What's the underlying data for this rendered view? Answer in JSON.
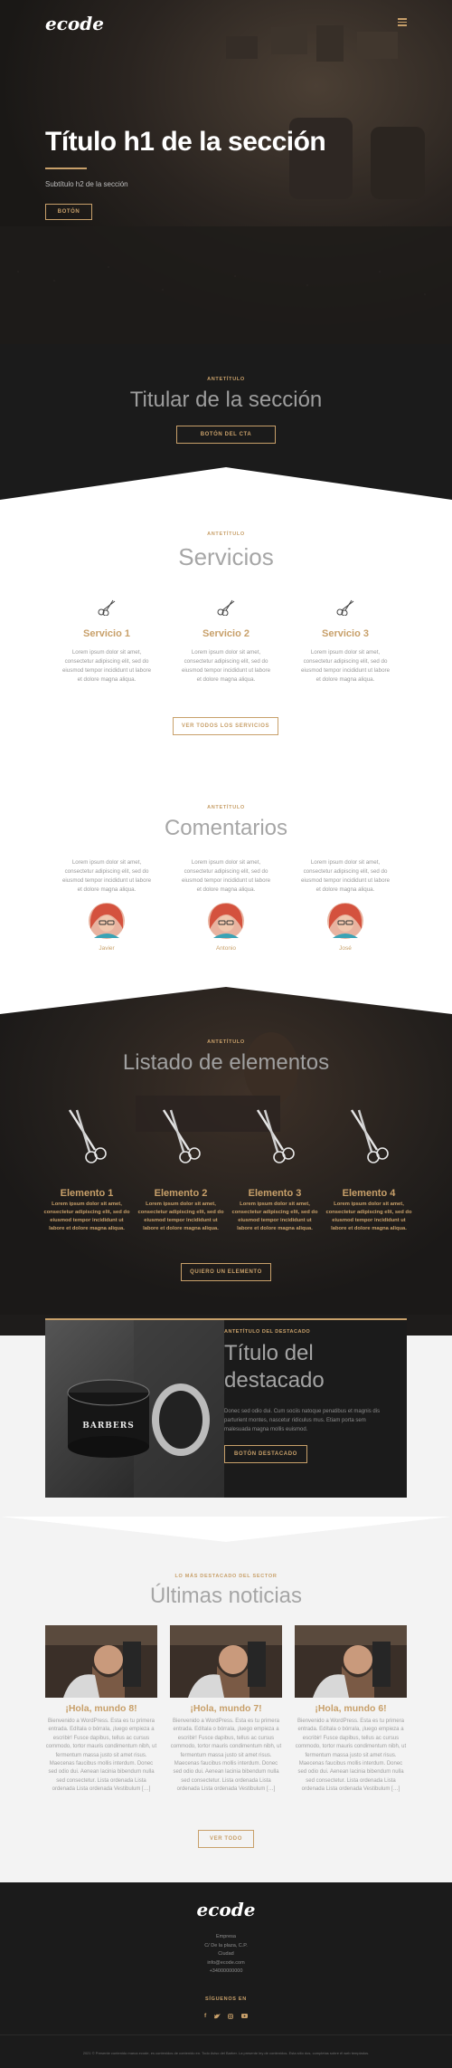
{
  "header": {
    "logo": "ecode",
    "menu_icon": "hamburger-icon"
  },
  "hero": {
    "title": "Título h1 de la sección",
    "subtitle": "Subtítulo h2 de la sección",
    "button": "BOTÓN"
  },
  "cta": {
    "eyebrow": "ANTETÍTULO",
    "title": "Titular de la sección",
    "button": "BOTÓN DEL CTA"
  },
  "services": {
    "eyebrow": "ANTETÍTULO",
    "title": "Servicios",
    "items": [
      {
        "title": "Servicio 1",
        "text": "Lorem ipsum dolor sit amet, consectetur adipiscing elit, sed do eiusmod tempor incididunt ut labore et dolore magna aliqua."
      },
      {
        "title": "Servicio 2",
        "text": "Lorem ipsum dolor sit amet, consectetur adipiscing elit, sed do eiusmod tempor incididunt ut labore et dolore magna aliqua."
      },
      {
        "title": "Servicio 3",
        "text": "Lorem ipsum dolor sit amet, consectetur adipiscing elit, sed do eiusmod tempor incididunt ut labore et dolore magna aliqua."
      }
    ],
    "button": "VER TODOS LOS SERVICIOS"
  },
  "comments": {
    "eyebrow": "ANTETÍTULO",
    "title": "Comentarios",
    "items": [
      {
        "text": "Lorem ipsum dolor sit amet, consectetur adipiscing elit, sed do eiusmod tempor incididunt ut labore et dolore magna aliqua.",
        "name": "Javier"
      },
      {
        "text": "Lorem ipsum dolor sit amet, consectetur adipiscing elit, sed do eiusmod tempor incididunt ut labore et dolore magna aliqua.",
        "name": "Antonio"
      },
      {
        "text": "Lorem ipsum dolor sit amet, consectetur adipiscing elit, sed do eiusmod tempor incididunt ut labore et dolore magna aliqua.",
        "name": "José"
      }
    ]
  },
  "elements": {
    "eyebrow": "ANTETÍTULO",
    "title": "Listado de elementos",
    "items": [
      {
        "title": "Elemento 1",
        "text": "Lorem ipsum dolor sit amet, consectetur adipiscing elit, sed do eiusmod tempor incididunt ut labore et dolore magna aliqua."
      },
      {
        "title": "Elemento 2",
        "text": "Lorem ipsum dolor sit amet, consectetur adipiscing elit, sed do eiusmod tempor incididunt ut labore et dolore magna aliqua."
      },
      {
        "title": "Elemento 3",
        "text": "Lorem ipsum dolor sit amet, consectetur adipiscing elit, sed do eiusmod tempor incididunt ut labore et dolore magna aliqua."
      },
      {
        "title": "Elemento 4",
        "text": "Lorem ipsum dolor sit amet, consectetur adipiscing elit, sed do eiusmod tempor incididunt ut labore et dolore magna aliqua."
      }
    ],
    "button": "QUIERO UN ELEMENTO"
  },
  "featured": {
    "eyebrow": "ANTETÍTULO DEL DESTACADO",
    "title_line1": "Título del",
    "title_line2": "destacado",
    "text": "Donec sed odio dui. Cum sociis natoque penatibus et magnis dis parturient montes, nascetur ridiculus mus. Etiam porta sem malesuada magna mollis euismod.",
    "button": "BOTÓN DESTACADO",
    "product_label": "BARBERS"
  },
  "news": {
    "eyebrow": "LO MÁS DESTACADO DEL SECTOR",
    "title": "Últimas noticias",
    "items": [
      {
        "title": "¡Hola, mundo 8!",
        "text": "Bienvenido a WordPress. Esta es tu primera entrada. Edítala o bórrala, ¡luego empieza a escribir! Fusce dapibus, tellus ac cursus commodo, tortor mauris condimentum nibh, ut fermentum massa justo sit amet risus. Maecenas faucibus mollis interdum. Donec sed odio dui. Aenean lacinia bibendum nulla sed consectetur. Lista ordenada Lista ordenada Lista ordenada Vestibulum […]"
      },
      {
        "title": "¡Hola, mundo 7!",
        "text": "Bienvenido a WordPress. Esta es tu primera entrada. Edítala o bórrala, ¡luego empieza a escribir! Fusce dapibus, tellus ac cursus commodo, tortor mauris condimentum nibh, ut fermentum massa justo sit amet risus. Maecenas faucibus mollis interdum. Donec sed odio dui. Aenean lacinia bibendum nulla sed consectetur. Lista ordenada Lista ordenada Lista ordenada Vestibulum […]"
      },
      {
        "title": "¡Hola, mundo 6!",
        "text": "Bienvenido a WordPress. Esta es tu primera entrada. Edítala o bórrala, ¡luego empieza a escribir! Fusce dapibus, tellus ac cursus commodo, tortor mauris condimentum nibh, ut fermentum massa justo sit amet risus. Maecenas faucibus mollis interdum. Donec sed odio dui. Aenean lacinia bibendum nulla sed consectetur. Lista ordenada Lista ordenada Lista ordenada Vestibulum […]"
      }
    ],
    "button": "VER TODO"
  },
  "footer": {
    "logo": "ecode",
    "address_lines": [
      "Empresa",
      "C/ De la plaza, C.P.",
      "Ciudad",
      "info@ecode.com",
      "+34000000000"
    ],
    "follow": "SÍGUENOS EN",
    "social": [
      "facebook-icon",
      "twitter-icon",
      "instagram-icon",
      "youtube-icon"
    ],
    "legal": "2021 © Presente contenido marca ecode, es contenidos de contenido en. Todo Aviso del Barber. La presente ley de contenidos. Esta sitio dos, completas sobre él web templados."
  },
  "colors": {
    "accent": "#c8a06a",
    "dark": "#1b1b1b",
    "light": "#f3f3f3"
  }
}
